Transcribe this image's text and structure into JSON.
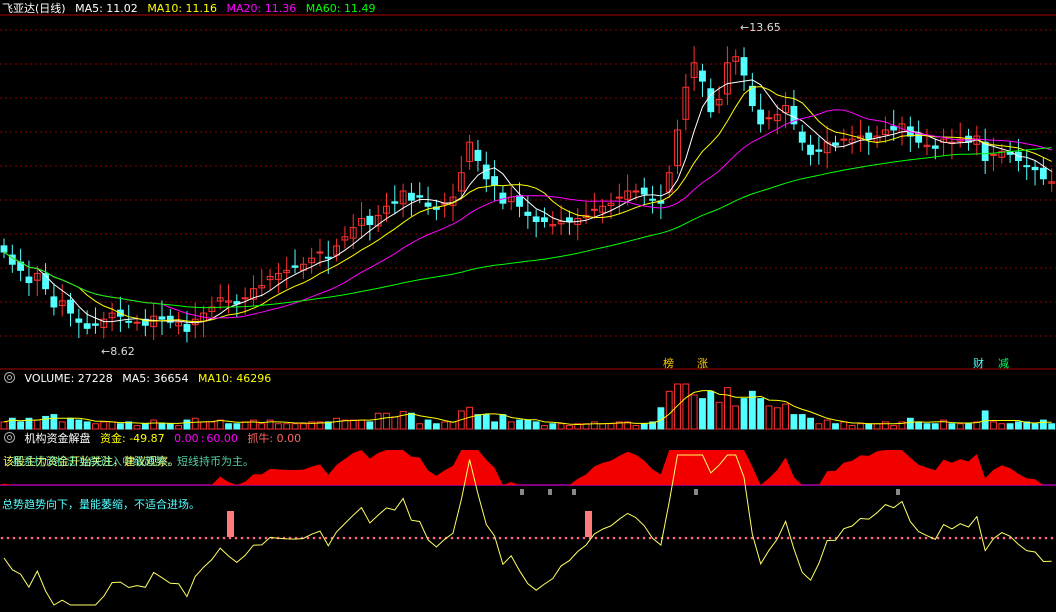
{
  "price_header": {
    "title": "飞亚达(日线)",
    "ma5": "MA5: 11.02",
    "ma10": "MA10: 11.16",
    "ma20": "MA20: 11.36",
    "ma60": "MA60: 11.49"
  },
  "volume_header": {
    "volume": "VOLUME: 27228",
    "ma5": "MA5: 36654",
    "ma10": "MA10: 46296"
  },
  "indicator_header": {
    "title": "机构资金解盘",
    "fund": "资金: -49.87",
    "v1": "0.00",
    "v2": "60.00",
    "grab": "抓牛: 0.00"
  },
  "annotations": {
    "high": "13.65",
    "low": "8.62",
    "tag_bang": "榜",
    "tag_zhang": "涨",
    "tag_cai": "财",
    "tag_jian": "减",
    "overlay_1": "该股主力资金开始关注，建议观察。",
    "overlay_2": "星系标识标志当前进入中级趋势，短线持币为主。",
    "advice": "总势趋势向下，量能萎缩，不适合进场。"
  },
  "colors": {
    "up": "#ff3232",
    "down": "#54ffff",
    "ma5": "#ffffff",
    "ma10": "#ffff00",
    "ma20": "#ff00ff",
    "ma60": "#00ff00",
    "fund_fill": "#ff0000",
    "fund_line": "#ffff66",
    "grid": "#8b0000"
  },
  "chart_data": [
    {
      "type": "candlestick",
      "title": "飞亚达(日线)",
      "y_high_marker": 13.65,
      "y_low_marker": 8.62,
      "ylim": [
        8.2,
        14.0
      ],
      "grid": true,
      "series": [
        {
          "name": "MA5",
          "value": 11.02
        },
        {
          "name": "MA10",
          "value": 11.16
        },
        {
          "name": "MA20",
          "value": 11.36
        },
        {
          "name": "MA60",
          "value": 11.49
        }
      ],
      "close": [
        10.1,
        9.9,
        9.8,
        9.6,
        9.75,
        9.5,
        9.2,
        9.3,
        9.1,
        8.95,
        8.85,
        8.9,
        9.0,
        9.1,
        9.05,
        8.95,
        8.95,
        8.9,
        9.05,
        9.0,
        8.95,
        8.95,
        8.8,
        9.0,
        9.1,
        9.2,
        9.35,
        9.3,
        9.25,
        9.35,
        9.5,
        9.55,
        9.7,
        9.75,
        9.8,
        9.85,
        9.9,
        10.0,
        10.1,
        10.0,
        10.2,
        10.35,
        10.5,
        10.65,
        10.55,
        10.7,
        10.85,
        10.9,
        11.1,
        10.95,
        11.0,
        10.85,
        10.8,
        10.9,
        11.0,
        11.4,
        11.9,
        11.6,
        11.3,
        11.2,
        10.9,
        11.0,
        10.85,
        10.7,
        10.6,
        10.6,
        10.55,
        10.6,
        10.6,
        10.65,
        10.7,
        10.8,
        10.85,
        10.9,
        11.0,
        11.1,
        11.1,
        11.05,
        10.95,
        10.9,
        11.4,
        12.1,
        12.8,
        13.2,
        12.9,
        12.4,
        12.6,
        13.2,
        13.3,
        13.0,
        12.5,
        12.2,
        12.3,
        12.35,
        12.5,
        12.2,
        11.9,
        11.7,
        11.75,
        11.9,
        11.85,
        11.95,
        11.95,
        12.0,
        11.95,
        12.0,
        12.1,
        12.1,
        12.2,
        12.0,
        11.9,
        11.85,
        11.8,
        11.95,
        11.9,
        11.95,
        11.9,
        12.0,
        11.6,
        11.7,
        11.75,
        11.7,
        11.6,
        11.5,
        11.45,
        11.3,
        11.25
      ],
      "xlabel": "",
      "ylabel": ""
    },
    {
      "type": "bar",
      "title": "VOLUME",
      "series": [
        {
          "name": "VOLUME",
          "value": 27228
        },
        {
          "name": "MA5",
          "value": 36654
        },
        {
          "name": "MA10",
          "value": 46296
        }
      ]
    },
    {
      "type": "area",
      "title": "机构资金解盘",
      "series": [
        {
          "name": "资金",
          "value": -49.87
        },
        {
          "name": "抓牛",
          "value": 0.0
        }
      ],
      "reference_lines": [
        0.0,
        60.0
      ]
    }
  ]
}
